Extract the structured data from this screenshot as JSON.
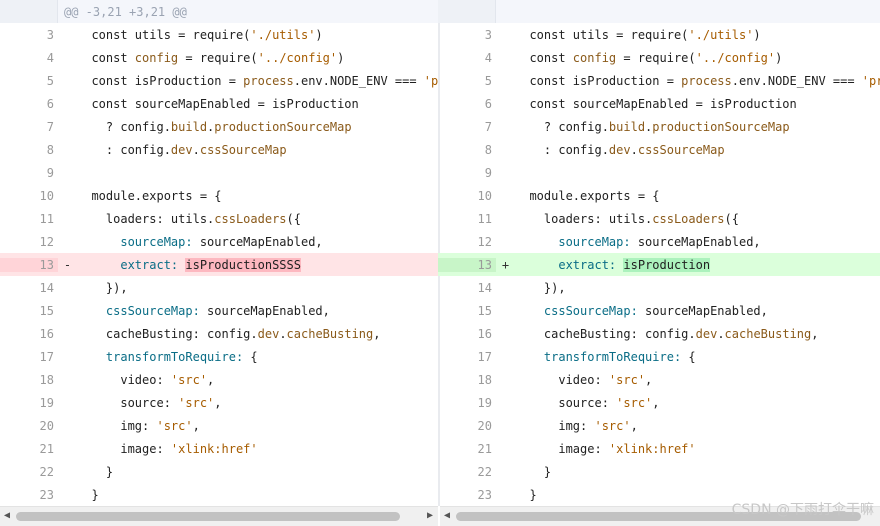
{
  "hunk_header": "@@ -3,21 +3,21 @@",
  "left_lines": [
    {
      "num": "3",
      "marker": "",
      "type": "normal",
      "tokens": [
        {
          "t": "  const utils = require("
        },
        {
          "t": "'./utils'",
          "c": "str"
        },
        {
          "t": ")"
        }
      ]
    },
    {
      "num": "4",
      "marker": "",
      "type": "normal",
      "tokens": [
        {
          "t": "  const "
        },
        {
          "t": "config",
          "c": "fn"
        },
        {
          "t": " = require("
        },
        {
          "t": "'../config'",
          "c": "str"
        },
        {
          "t": ")"
        }
      ]
    },
    {
      "num": "5",
      "marker": "",
      "type": "normal",
      "tokens": [
        {
          "t": "  const isProduction = "
        },
        {
          "t": "process",
          "c": "fn"
        },
        {
          "t": ".env.NODE_ENV === "
        },
        {
          "t": "'production'",
          "c": "str"
        }
      ]
    },
    {
      "num": "6",
      "marker": "",
      "type": "normal",
      "tokens": [
        {
          "t": "  const sourceMapEnabled = isProduction"
        }
      ]
    },
    {
      "num": "7",
      "marker": "",
      "type": "normal",
      "tokens": [
        {
          "t": "    ? config."
        },
        {
          "t": "build",
          "c": "fn"
        },
        {
          "t": "."
        },
        {
          "t": "productionSourceMap",
          "c": "fn"
        }
      ]
    },
    {
      "num": "8",
      "marker": "",
      "type": "normal",
      "tokens": [
        {
          "t": "    : config."
        },
        {
          "t": "dev",
          "c": "fn"
        },
        {
          "t": "."
        },
        {
          "t": "cssSourceMap",
          "c": "fn"
        }
      ]
    },
    {
      "num": "9",
      "marker": "",
      "type": "normal",
      "tokens": [
        {
          "t": ""
        }
      ]
    },
    {
      "num": "10",
      "marker": "",
      "type": "normal",
      "tokens": [
        {
          "t": "  module"
        },
        {
          "t": ".exports = {"
        }
      ]
    },
    {
      "num": "11",
      "marker": "",
      "type": "normal",
      "tokens": [
        {
          "t": "    loaders: utils."
        },
        {
          "t": "cssLoaders",
          "c": "fn"
        },
        {
          "t": "({"
        }
      ]
    },
    {
      "num": "12",
      "marker": "",
      "type": "normal",
      "tokens": [
        {
          "t": "      "
        },
        {
          "t": "sourceMap:",
          "c": "prop"
        },
        {
          "t": " sourceMapEnabled,"
        }
      ]
    },
    {
      "num": "13",
      "marker": "-",
      "type": "del",
      "tokens": [
        {
          "t": "      "
        },
        {
          "t": "extract:",
          "c": "prop"
        },
        {
          "t": " "
        },
        {
          "t": "isProductionSSSS",
          "c": "hl-del"
        }
      ]
    },
    {
      "num": "14",
      "marker": "",
      "type": "normal",
      "tokens": [
        {
          "t": "    }),"
        }
      ]
    },
    {
      "num": "15",
      "marker": "",
      "type": "normal",
      "tokens": [
        {
          "t": "    "
        },
        {
          "t": "cssSourceMap:",
          "c": "prop"
        },
        {
          "t": " sourceMapEnabled,"
        }
      ]
    },
    {
      "num": "16",
      "marker": "",
      "type": "normal",
      "tokens": [
        {
          "t": "    cacheBusting: config."
        },
        {
          "t": "dev",
          "c": "fn"
        },
        {
          "t": "."
        },
        {
          "t": "cacheBusting",
          "c": "fn"
        },
        {
          "t": ","
        }
      ]
    },
    {
      "num": "17",
      "marker": "",
      "type": "normal",
      "tokens": [
        {
          "t": "    "
        },
        {
          "t": "transformToRequire:",
          "c": "prop"
        },
        {
          "t": " {"
        }
      ]
    },
    {
      "num": "18",
      "marker": "",
      "type": "normal",
      "tokens": [
        {
          "t": "      video: "
        },
        {
          "t": "'src'",
          "c": "str"
        },
        {
          "t": ","
        }
      ]
    },
    {
      "num": "19",
      "marker": "",
      "type": "normal",
      "tokens": [
        {
          "t": "      source: "
        },
        {
          "t": "'src'",
          "c": "str"
        },
        {
          "t": ","
        }
      ]
    },
    {
      "num": "20",
      "marker": "",
      "type": "normal",
      "tokens": [
        {
          "t": "      img: "
        },
        {
          "t": "'src'",
          "c": "str"
        },
        {
          "t": ","
        }
      ]
    },
    {
      "num": "21",
      "marker": "",
      "type": "normal",
      "tokens": [
        {
          "t": "      image: "
        },
        {
          "t": "'xlink:href'",
          "c": "str"
        }
      ]
    },
    {
      "num": "22",
      "marker": "",
      "type": "normal",
      "tokens": [
        {
          "t": "    }"
        }
      ]
    },
    {
      "num": "23",
      "marker": "",
      "type": "normal",
      "tokens": [
        {
          "t": "  }"
        }
      ]
    }
  ],
  "right_lines": [
    {
      "num": "3",
      "marker": "",
      "type": "normal",
      "tokens": [
        {
          "t": "  const utils = require("
        },
        {
          "t": "'./utils'",
          "c": "str"
        },
        {
          "t": ")"
        }
      ]
    },
    {
      "num": "4",
      "marker": "",
      "type": "normal",
      "tokens": [
        {
          "t": "  const "
        },
        {
          "t": "config",
          "c": "fn"
        },
        {
          "t": " = require("
        },
        {
          "t": "'../config'",
          "c": "str"
        },
        {
          "t": ")"
        }
      ]
    },
    {
      "num": "5",
      "marker": "",
      "type": "normal",
      "tokens": [
        {
          "t": "  const isProduction = "
        },
        {
          "t": "process",
          "c": "fn"
        },
        {
          "t": ".env.NODE_ENV === "
        },
        {
          "t": "'production'",
          "c": "str"
        }
      ]
    },
    {
      "num": "6",
      "marker": "",
      "type": "normal",
      "tokens": [
        {
          "t": "  const sourceMapEnabled = isProduction"
        }
      ]
    },
    {
      "num": "7",
      "marker": "",
      "type": "normal",
      "tokens": [
        {
          "t": "    ? config."
        },
        {
          "t": "build",
          "c": "fn"
        },
        {
          "t": "."
        },
        {
          "t": "productionSourceMap",
          "c": "fn"
        }
      ]
    },
    {
      "num": "8",
      "marker": "",
      "type": "normal",
      "tokens": [
        {
          "t": "    : config."
        },
        {
          "t": "dev",
          "c": "fn"
        },
        {
          "t": "."
        },
        {
          "t": "cssSourceMap",
          "c": "fn"
        }
      ]
    },
    {
      "num": "9",
      "marker": "",
      "type": "normal",
      "tokens": [
        {
          "t": ""
        }
      ]
    },
    {
      "num": "10",
      "marker": "",
      "type": "normal",
      "tokens": [
        {
          "t": "  module"
        },
        {
          "t": ".exports = {"
        }
      ]
    },
    {
      "num": "11",
      "marker": "",
      "type": "normal",
      "tokens": [
        {
          "t": "    loaders: utils."
        },
        {
          "t": "cssLoaders",
          "c": "fn"
        },
        {
          "t": "({"
        }
      ]
    },
    {
      "num": "12",
      "marker": "",
      "type": "normal",
      "tokens": [
        {
          "t": "      "
        },
        {
          "t": "sourceMap:",
          "c": "prop"
        },
        {
          "t": " sourceMapEnabled,"
        }
      ]
    },
    {
      "num": "13",
      "marker": "+",
      "type": "add",
      "tokens": [
        {
          "t": "      "
        },
        {
          "t": "extract:",
          "c": "prop"
        },
        {
          "t": " "
        },
        {
          "t": "isProduction",
          "c": "hl-add"
        }
      ]
    },
    {
      "num": "14",
      "marker": "",
      "type": "normal",
      "tokens": [
        {
          "t": "    }),"
        }
      ]
    },
    {
      "num": "15",
      "marker": "",
      "type": "normal",
      "tokens": [
        {
          "t": "    "
        },
        {
          "t": "cssSourceMap:",
          "c": "prop"
        },
        {
          "t": " sourceMapEnabled,"
        }
      ]
    },
    {
      "num": "16",
      "marker": "",
      "type": "normal",
      "tokens": [
        {
          "t": "    cacheBusting: config."
        },
        {
          "t": "dev",
          "c": "fn"
        },
        {
          "t": "."
        },
        {
          "t": "cacheBusting",
          "c": "fn"
        },
        {
          "t": ","
        }
      ]
    },
    {
      "num": "17",
      "marker": "",
      "type": "normal",
      "tokens": [
        {
          "t": "    "
        },
        {
          "t": "transformToRequire:",
          "c": "prop"
        },
        {
          "t": " {"
        }
      ]
    },
    {
      "num": "18",
      "marker": "",
      "type": "normal",
      "tokens": [
        {
          "t": "      video: "
        },
        {
          "t": "'src'",
          "c": "str"
        },
        {
          "t": ","
        }
      ]
    },
    {
      "num": "19",
      "marker": "",
      "type": "normal",
      "tokens": [
        {
          "t": "      source: "
        },
        {
          "t": "'src'",
          "c": "str"
        },
        {
          "t": ","
        }
      ]
    },
    {
      "num": "20",
      "marker": "",
      "type": "normal",
      "tokens": [
        {
          "t": "      img: "
        },
        {
          "t": "'src'",
          "c": "str"
        },
        {
          "t": ","
        }
      ]
    },
    {
      "num": "21",
      "marker": "",
      "type": "normal",
      "tokens": [
        {
          "t": "      image: "
        },
        {
          "t": "'xlink:href'",
          "c": "str"
        }
      ]
    },
    {
      "num": "22",
      "marker": "",
      "type": "normal",
      "tokens": [
        {
          "t": "    }"
        }
      ]
    },
    {
      "num": "23",
      "marker": "",
      "type": "normal",
      "tokens": [
        {
          "t": "  }"
        }
      ]
    }
  ],
  "scrollbar": {
    "left_arrow": "◀",
    "right_arrow": "▶"
  },
  "watermark": "CSDN @下雨打伞干嘛",
  "colors": {
    "deleted_line": "#ffe4e6",
    "added_line": "#dbffdb",
    "deleted_word": "#fdb8c0",
    "added_word": "#acf2bd"
  }
}
